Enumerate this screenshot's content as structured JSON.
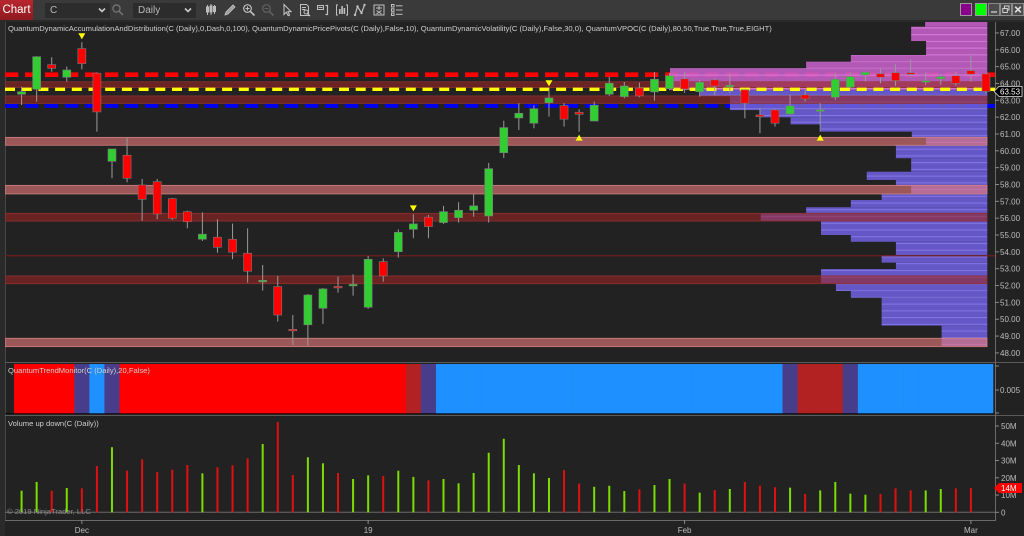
{
  "toolbar": {
    "tab_label": "Chart",
    "instrument": "C",
    "interval": "Daily",
    "tool_icons": [
      "candlestick-bars-icon",
      "pencil-icon",
      "zoom-in-icon",
      "zoom-out-icon",
      "pointer-icon",
      "data-box-icon",
      "chart-trader-icon",
      "indicators-icon",
      "strategies-icon",
      "properties-icon",
      "list-icon"
    ],
    "link_swatches": [
      {
        "name": "purple",
        "color": "#8b008b"
      },
      {
        "name": "green",
        "color": "#00ff00"
      }
    ]
  },
  "colors": {
    "candle_up": "#32cd32",
    "candle_down": "#ff0000",
    "wick": "#9a9a9a",
    "volume_up": "#7cdc00",
    "volume_down": "#e01010",
    "signal_marker": "#ffff00",
    "zone_strong": "rgba(154,37,37,0.6)",
    "zone_strong_border": "#8e3030",
    "zone_weak": "rgba(230,121,121,0.62)",
    "zone_weak_border": "#d08080",
    "profile_upper": "rgba(198,96,202,0.88)",
    "profile_upper_line": "rgba(222,128,228,0.9)",
    "profile_lower": "rgba(106,92,212,0.92)",
    "profile_lower_line": "rgba(134,120,232,0.95)",
    "last_price_bg": "#000000",
    "last_volume_bg": "#ff0000"
  },
  "chart_data": [
    {
      "panel": "price",
      "type": "bar",
      "subtype": "candlestick",
      "title": "QuantumDynamicAccumulationAndDistribution(C (Daily),0,Dash,0,100), QuantumDynamicPricePivots(C (Daily),False,10), QuantumDynamicVolatility(C (Daily),False,30,0), QuantumVPOC(C (Daily),80,50,True,True,True,EIGHT)",
      "xlabel": "",
      "ylabel": "",
      "grid": false,
      "y_range": [
        47.46,
        67.65
      ],
      "x_range": [
        -1.1,
        64.4
      ],
      "y_ticks": [
        67,
        66,
        65,
        64,
        63,
        62,
        61,
        60,
        59,
        58,
        57,
        56,
        55,
        54,
        53,
        52,
        51,
        50,
        49,
        48
      ],
      "y_tick_labels": [
        "67.00",
        "66.00",
        "65.00",
        "64.00",
        "63.00",
        "62.00",
        "61.00",
        "60.00",
        "59.00",
        "58.00",
        "57.00",
        "56.00",
        "55.00",
        "54.00",
        "53.00",
        "52.00",
        "51.00",
        "50.00",
        "49.00",
        "48.00"
      ],
      "last_price": 63.53,
      "last_price_label": "63.53",
      "bar_fields": [
        "open",
        "high",
        "low",
        "close"
      ],
      "bars": [
        [
          63.36,
          63.81,
          62.72,
          63.51
        ],
        [
          63.66,
          65.62,
          62.92,
          65.59
        ],
        [
          65.12,
          65.56,
          64.7,
          64.9
        ],
        [
          64.37,
          65.0,
          64.11,
          64.8
        ],
        [
          66.07,
          66.45,
          64.84,
          65.18
        ],
        [
          64.61,
          64.65,
          61.14,
          62.31
        ],
        [
          59.38,
          60.11,
          58.37,
          60.11
        ],
        [
          59.74,
          60.75,
          58.13,
          58.37
        ],
        [
          57.97,
          58.33,
          55.85,
          57.12
        ],
        [
          58.17,
          58.33,
          55.94,
          56.25
        ],
        [
          57.16,
          57.2,
          55.9,
          56.0
        ],
        [
          56.39,
          56.45,
          55.4,
          55.79
        ],
        [
          54.75,
          56.35,
          54.65,
          55.05
        ],
        [
          54.87,
          55.94,
          53.95,
          54.27
        ],
        [
          54.75,
          55.68,
          53.56,
          53.98
        ],
        [
          53.92,
          55.4,
          52.17,
          52.85
        ],
        [
          52.27,
          53.22,
          51.7,
          52.31
        ],
        [
          51.94,
          52.57,
          49.86,
          50.25
        ],
        [
          49.4,
          50.25,
          48.47,
          49.32
        ],
        [
          49.67,
          51.5,
          48.43,
          51.44
        ],
        [
          50.65,
          51.85,
          49.72,
          51.8
        ],
        [
          51.95,
          52.53,
          51.58,
          51.88
        ],
        [
          52.0,
          52.67,
          51.4,
          52.07
        ],
        [
          50.71,
          53.76,
          50.61,
          53.56
        ],
        [
          53.42,
          53.62,
          52.23,
          52.57
        ],
        [
          54.01,
          55.34,
          53.66,
          55.16
        ],
        [
          55.34,
          56.23,
          54.81,
          55.66
        ],
        [
          56.06,
          56.19,
          54.81,
          55.5
        ],
        [
          55.74,
          56.73,
          55.66,
          56.39
        ],
        [
          56.03,
          56.95,
          55.74,
          56.47
        ],
        [
          56.47,
          57.44,
          56.09,
          56.73
        ],
        [
          56.13,
          59.28,
          55.74,
          58.94
        ],
        [
          59.89,
          61.79,
          59.58,
          61.38
        ],
        [
          61.95,
          62.83,
          61.24,
          62.23
        ],
        [
          61.64,
          62.71,
          61.34,
          62.5
        ],
        [
          62.86,
          63.66,
          62.03,
          63.14
        ],
        [
          62.68,
          62.83,
          61.44,
          61.88
        ],
        [
          62.29,
          62.47,
          61.14,
          62.17
        ],
        [
          61.77,
          62.92,
          61.77,
          62.71
        ],
        [
          63.36,
          64.4,
          63.26,
          64.01
        ],
        [
          63.22,
          64.09,
          63.12,
          63.85
        ],
        [
          63.73,
          64.05,
          63.18,
          63.26
        ],
        [
          63.5,
          64.68,
          62.98,
          64.25
        ],
        [
          63.69,
          64.61,
          63.6,
          64.46
        ],
        [
          64.27,
          64.67,
          63.45,
          63.67
        ],
        [
          63.51,
          64.21,
          63.22,
          64.07
        ],
        [
          64.21,
          64.31,
          63.32,
          63.85
        ],
        [
          63.85,
          64.61,
          63.42,
          63.89
        ],
        [
          63.62,
          63.66,
          61.93,
          62.83
        ],
        [
          62.13,
          62.53,
          61.04,
          62.03
        ],
        [
          62.43,
          62.49,
          61.44,
          61.64
        ],
        [
          62.19,
          63.32,
          62.15,
          62.67
        ],
        [
          63.32,
          63.62,
          62.92,
          63.08
        ],
        [
          62.39,
          62.83,
          61.14,
          62.43
        ],
        [
          63.18,
          64.61,
          63.02,
          64.25
        ],
        [
          63.78,
          64.64,
          63.72,
          64.4
        ],
        [
          64.51,
          64.7,
          64.11,
          64.67
        ],
        [
          64.57,
          64.9,
          64.01,
          64.37
        ],
        [
          64.64,
          65.14,
          63.85,
          64.17
        ],
        [
          64.63,
          65.44,
          64.4,
          64.59
        ],
        [
          64.13,
          64.67,
          63.91,
          64.17
        ],
        [
          64.27,
          64.55,
          63.91,
          64.4
        ],
        [
          64.46,
          64.7,
          63.87,
          64.01
        ],
        [
          64.76,
          65.69,
          64.11,
          64.55
        ],
        [
          64.57,
          64.62,
          63.4,
          63.53
        ]
      ],
      "signal_markers": [
        {
          "bar": 4,
          "direction": "down"
        },
        {
          "bar": 26,
          "direction": "down"
        },
        {
          "bar": 35,
          "direction": "down"
        },
        {
          "bar": 37,
          "direction": "up"
        },
        {
          "bar": 53,
          "direction": "up"
        }
      ],
      "levels": [
        {
          "id": "upper",
          "price": 64.52,
          "color": "#ff0000"
        },
        {
          "id": "lower",
          "price": 62.67,
          "color": "#0000ff"
        },
        {
          "id": "vpoc",
          "price": 63.65,
          "color": "#ffff00"
        }
      ],
      "zones": [
        {
          "high": 64.1,
          "low": 63.75,
          "kind": "strong"
        },
        {
          "high": 63.26,
          "low": 62.82,
          "kind": "strong"
        },
        {
          "high": 60.8,
          "low": 60.33,
          "kind": "weak"
        },
        {
          "high": 57.95,
          "low": 57.44,
          "kind": "weak"
        },
        {
          "high": 56.29,
          "low": 55.83,
          "kind": "strong"
        },
        {
          "high": 52.57,
          "low": 52.11,
          "kind": "strong"
        },
        {
          "high": 48.87,
          "low": 48.37,
          "kind": "weak"
        }
      ],
      "thin_lines": [
        {
          "price": 53.77,
          "color": "#6e1e1e"
        }
      ],
      "volume_profile": [
        {
          "high": 67.73,
          "low": 67.37,
          "rel_volume": 0.196,
          "zone": "upper"
        },
        {
          "high": 67.37,
          "low": 66.52,
          "rel_volume": 0.24,
          "zone": "upper"
        },
        {
          "high": 66.52,
          "low": 65.69,
          "rel_volume": 0.193,
          "zone": "upper"
        },
        {
          "high": 65.69,
          "low": 65.29,
          "rel_volume": 0.43,
          "zone": "upper"
        },
        {
          "high": 65.29,
          "low": 64.9,
          "rel_volume": 0.571,
          "zone": "upper"
        },
        {
          "high": 64.9,
          "low": 63.61,
          "rel_volume": 1.0,
          "zone": "upper"
        },
        {
          "high": 63.61,
          "low": 63.27,
          "rel_volume": 0.905,
          "zone": "lower"
        },
        {
          "high": 63.27,
          "low": 62.42,
          "rel_volume": 0.811,
          "zone": "lower"
        },
        {
          "high": 62.42,
          "low": 61.99,
          "rel_volume": 0.716,
          "zone": "lower"
        },
        {
          "high": 61.99,
          "low": 61.57,
          "rel_volume": 0.62,
          "zone": "lower"
        },
        {
          "high": 61.57,
          "low": 61.14,
          "rel_volume": 0.525,
          "zone": "lower"
        },
        {
          "high": 61.14,
          "low": 60.8,
          "rel_volume": 0.238,
          "zone": "lower"
        },
        {
          "high": 60.8,
          "low": 60.35,
          "rel_volume": 0.193,
          "zone": "lower"
        },
        {
          "high": 60.35,
          "low": 59.56,
          "rel_volume": 0.288,
          "zone": "lower"
        },
        {
          "high": 59.56,
          "low": 58.76,
          "rel_volume": 0.24,
          "zone": "lower"
        },
        {
          "high": 58.76,
          "low": 58.27,
          "rel_volume": 0.38,
          "zone": "lower"
        },
        {
          "high": 58.27,
          "low": 57.91,
          "rel_volume": 0.288,
          "zone": "lower"
        },
        {
          "high": 57.91,
          "low": 57.44,
          "rel_volume": 0.24,
          "zone": "lower"
        },
        {
          "high": 57.44,
          "low": 57.08,
          "rel_volume": 0.333,
          "zone": "lower"
        },
        {
          "high": 57.08,
          "low": 56.65,
          "rel_volume": 0.43,
          "zone": "lower"
        },
        {
          "high": 56.65,
          "low": 56.29,
          "rel_volume": 0.571,
          "zone": "lower"
        },
        {
          "high": 56.29,
          "low": 55.83,
          "rel_volume": 0.714,
          "zone": "lower"
        },
        {
          "high": 55.83,
          "low": 55.0,
          "rel_volume": 0.524,
          "zone": "lower"
        },
        {
          "high": 55.0,
          "low": 54.6,
          "rel_volume": 0.43,
          "zone": "lower"
        },
        {
          "high": 54.6,
          "low": 53.81,
          "rel_volume": 0.288,
          "zone": "lower"
        },
        {
          "high": 53.81,
          "low": 53.36,
          "rel_volume": 0.333,
          "zone": "lower"
        },
        {
          "high": 53.36,
          "low": 52.98,
          "rel_volume": 0.288,
          "zone": "lower"
        },
        {
          "high": 52.98,
          "low": 52.13,
          "rel_volume": 0.524,
          "zone": "lower"
        },
        {
          "high": 52.13,
          "low": 51.68,
          "rel_volume": 0.477,
          "zone": "lower"
        },
        {
          "high": 51.68,
          "low": 51.28,
          "rel_volume": 0.43,
          "zone": "lower"
        },
        {
          "high": 51.28,
          "low": 49.62,
          "rel_volume": 0.333,
          "zone": "lower"
        },
        {
          "high": 49.62,
          "low": 48.41,
          "rel_volume": 0.144,
          "zone": "lower"
        }
      ]
    },
    {
      "panel": "trend",
      "type": "heatmap",
      "title": "QuantumTrendMonitor(C (Daily),20,False)",
      "y_tick_labels": [
        "0.005"
      ],
      "state_colors": {
        "down": "#ff0000",
        "down-weak": "#b22222",
        "neutral": "#483d8b",
        "up": "#1e90ff"
      },
      "states": [
        "down",
        "down",
        "down",
        "down",
        "neutral",
        "up",
        "neutral",
        "down",
        "down",
        "down",
        "down",
        "down",
        "down",
        "down",
        "down",
        "down",
        "down",
        "down",
        "down",
        "down",
        "down",
        "down",
        "down",
        "down",
        "down",
        "down",
        "down-weak",
        "neutral",
        "up",
        "up",
        "up",
        "up",
        "up",
        "up",
        "up",
        "up",
        "up",
        "up",
        "up",
        "up",
        "up",
        "up",
        "up",
        "up",
        "up",
        "up",
        "up",
        "up",
        "up",
        "up",
        "up",
        "neutral",
        "down-weak",
        "down-weak",
        "down-weak",
        "neutral",
        "up",
        "up",
        "up",
        "up",
        "up",
        "up",
        "up",
        "up",
        "up"
      ]
    },
    {
      "panel": "volume",
      "type": "bar",
      "title": "Volume up down(C (Daily))",
      "ylabel": "",
      "units": "M",
      "y_range": [
        -3.3,
        55.8
      ],
      "y_ticks": [
        50,
        40,
        30,
        20,
        10,
        0
      ],
      "y_tick_labels": [
        "50M",
        "40M",
        "30M",
        "20M",
        "10M",
        "0"
      ],
      "last_value": 14.1,
      "last_label": "14M",
      "values": [
        12.5,
        17.6,
        12.5,
        14.1,
        13.9,
        26.8,
        37.7,
        24.1,
        30.7,
        23.3,
        24.7,
        27.4,
        22.6,
        26.1,
        27.2,
        31.3,
        39.6,
        52.3,
        21.6,
        31.9,
        28.4,
        22.8,
        19.3,
        21.4,
        21.0,
        24.1,
        20.5,
        18.5,
        19.3,
        16.8,
        22.8,
        34.5,
        42.6,
        27.4,
        22.6,
        19.9,
        24.5,
        16.6,
        14.8,
        15.4,
        12.3,
        13.3,
        15.8,
        19.3,
        16.6,
        11.4,
        12.9,
        13.5,
        17.6,
        15.4,
        14.5,
        14.3,
        10.6,
        12.7,
        17.6,
        10.8,
        10.2,
        10.6,
        13.9,
        12.7,
        12.7,
        13.5,
        13.9,
        14.1,
        null
      ],
      "direction": [
        "up",
        "up",
        "down",
        "up",
        "down",
        "down",
        "up",
        "down",
        "down",
        "down",
        "down",
        "down",
        "up",
        "down",
        "down",
        "down",
        "up",
        "down",
        "down",
        "up",
        "up",
        "down",
        "up",
        "up",
        "down",
        "up",
        "up",
        "down",
        "up",
        "up",
        "up",
        "up",
        "up",
        "up",
        "up",
        "up",
        "down",
        "down",
        "up",
        "up",
        "up",
        "down",
        "up",
        "up",
        "down",
        "up",
        "down",
        "up",
        "down",
        "down",
        "down",
        "up",
        "down",
        "up",
        "up",
        "up",
        "up",
        "down",
        "down",
        "down",
        "up",
        "up",
        "down",
        "down",
        null
      ]
    }
  ],
  "x_axis": {
    "ticks": [
      {
        "label": "Dec",
        "bar": 4
      },
      {
        "label": "19",
        "bar": 23
      },
      {
        "label": "Feb",
        "bar": 44
      },
      {
        "label": "Mar",
        "bar": 63
      }
    ]
  },
  "footer": {
    "copyright": "© 2019 NinjaTrader, LLC"
  }
}
